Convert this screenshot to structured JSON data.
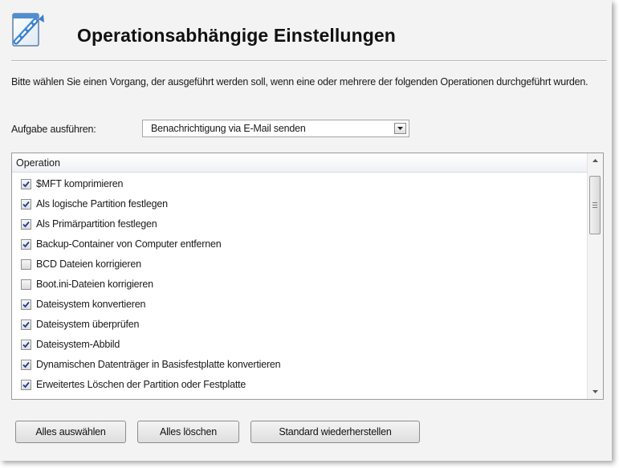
{
  "header": {
    "title": "Operationsabhängige Einstellungen",
    "icon": "document-link-icon"
  },
  "description": "Bitte wählen Sie einen Vorgang, der ausgeführt werden soll, wenn eine oder mehrere der folgenden Operationen durchgeführt wurden.",
  "task": {
    "label": "Aufgabe ausführen:",
    "selected": "Benachrichtigung via E-Mail senden"
  },
  "operations": {
    "column_header": "Operation",
    "items": [
      {
        "label": "$MFT komprimieren",
        "checked": true
      },
      {
        "label": "Als logische Partition festlegen",
        "checked": true
      },
      {
        "label": "Als Primärpartition festlegen",
        "checked": true
      },
      {
        "label": "Backup-Container von Computer entfernen",
        "checked": true
      },
      {
        "label": "BCD Dateien korrigieren",
        "checked": false
      },
      {
        "label": "Boot.ini-Dateien korrigieren",
        "checked": false
      },
      {
        "label": "Dateisystem konvertieren",
        "checked": true
      },
      {
        "label": "Dateisystem überprüfen",
        "checked": true
      },
      {
        "label": "Dateisystem-Abbild",
        "checked": true
      },
      {
        "label": "Dynamischen Datenträger in Basisfestplatte konvertieren",
        "checked": true
      },
      {
        "label": "Erweitertes Löschen der Partition oder Festplatte",
        "checked": true
      }
    ]
  },
  "buttons": {
    "select_all": "Alles auswählen",
    "clear_all": "Alles löschen",
    "restore_default": "Standard wiederherstellen"
  },
  "colors": {
    "panel_bg": "#f3f3f3",
    "check_blue": "#1c3f8a",
    "icon_blue": "#2a7fd4"
  }
}
